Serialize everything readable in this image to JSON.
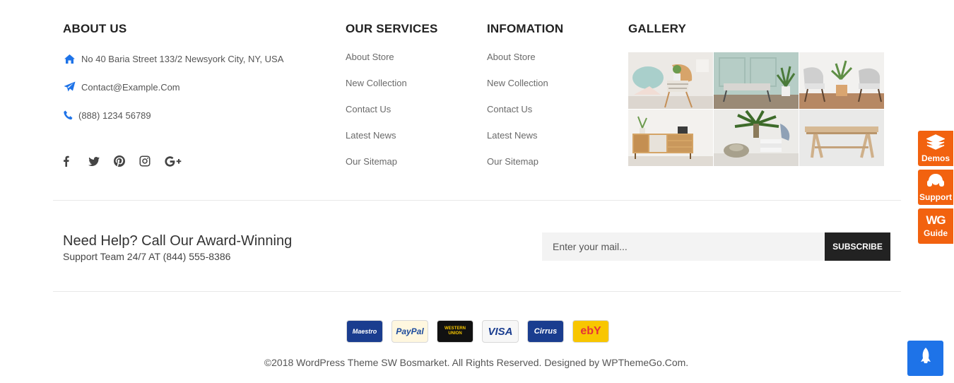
{
  "about": {
    "title": "ABOUT US",
    "address": "No 40 Baria Street 133/2 Newsyork City, NY, USA",
    "email": "Contact@Example.Com",
    "phone": "(888) 1234 56789",
    "icons": [
      "home-icon",
      "paper-plane-icon",
      "phone-icon"
    ],
    "socials": [
      "facebook-icon",
      "twitter-icon",
      "pinterest-icon",
      "instagram-icon",
      "google-plus-icon"
    ]
  },
  "services": {
    "title": "OUR SERVICES",
    "links": [
      "About Store",
      "New Collection",
      "Contact Us",
      "Latest News",
      "Our Sitemap"
    ]
  },
  "information": {
    "title": "INFOMATION",
    "links": [
      "About Store",
      "New Collection",
      "Contact Us",
      "Latest News",
      "Our Sitemap"
    ]
  },
  "gallery": {
    "title": "GALLERY",
    "images": [
      "chair-image",
      "bench-image",
      "armchair-image",
      "sideboard-image",
      "plant-vase-image",
      "wooden-table-image"
    ]
  },
  "help": {
    "title": "Need Help? Call Our Award-Winning",
    "subtitle": "Support Team 24/7 AT (844) 555-8386"
  },
  "newsletter": {
    "placeholder": "Enter your mail...",
    "button": "SUBSCRIBE"
  },
  "payments": [
    {
      "name": "Maestro",
      "bg": "#1a3d8f",
      "fg": "#ffffff"
    },
    {
      "name": "PayPal",
      "bg": "#fff7df",
      "fg": "#1b4a9c"
    },
    {
      "name": "WESTERN UNION",
      "bg": "#111111",
      "fg": "#f6c500"
    },
    {
      "name": "VISA",
      "bg": "#f7f7f7",
      "fg": "#1a3d8f"
    },
    {
      "name": "Cirrus",
      "bg": "#1a3d8f",
      "fg": "#ffffff"
    },
    {
      "name": "ebY",
      "bg": "#f8c600",
      "fg": "#e53238"
    }
  ],
  "copyright": "©2018 WordPress Theme SW Bosmarket. All Rights Reserved. Designed by WPThemeGo.Com.",
  "side_buttons": [
    {
      "label": "Demos",
      "icon": "layers-icon"
    },
    {
      "label": "Support",
      "icon": "headset-icon"
    },
    {
      "label": "Guide",
      "icon": "wg-logo-icon",
      "logo_text": "WG"
    }
  ],
  "accent": "#1e73e8",
  "side_color": "#f2620f"
}
